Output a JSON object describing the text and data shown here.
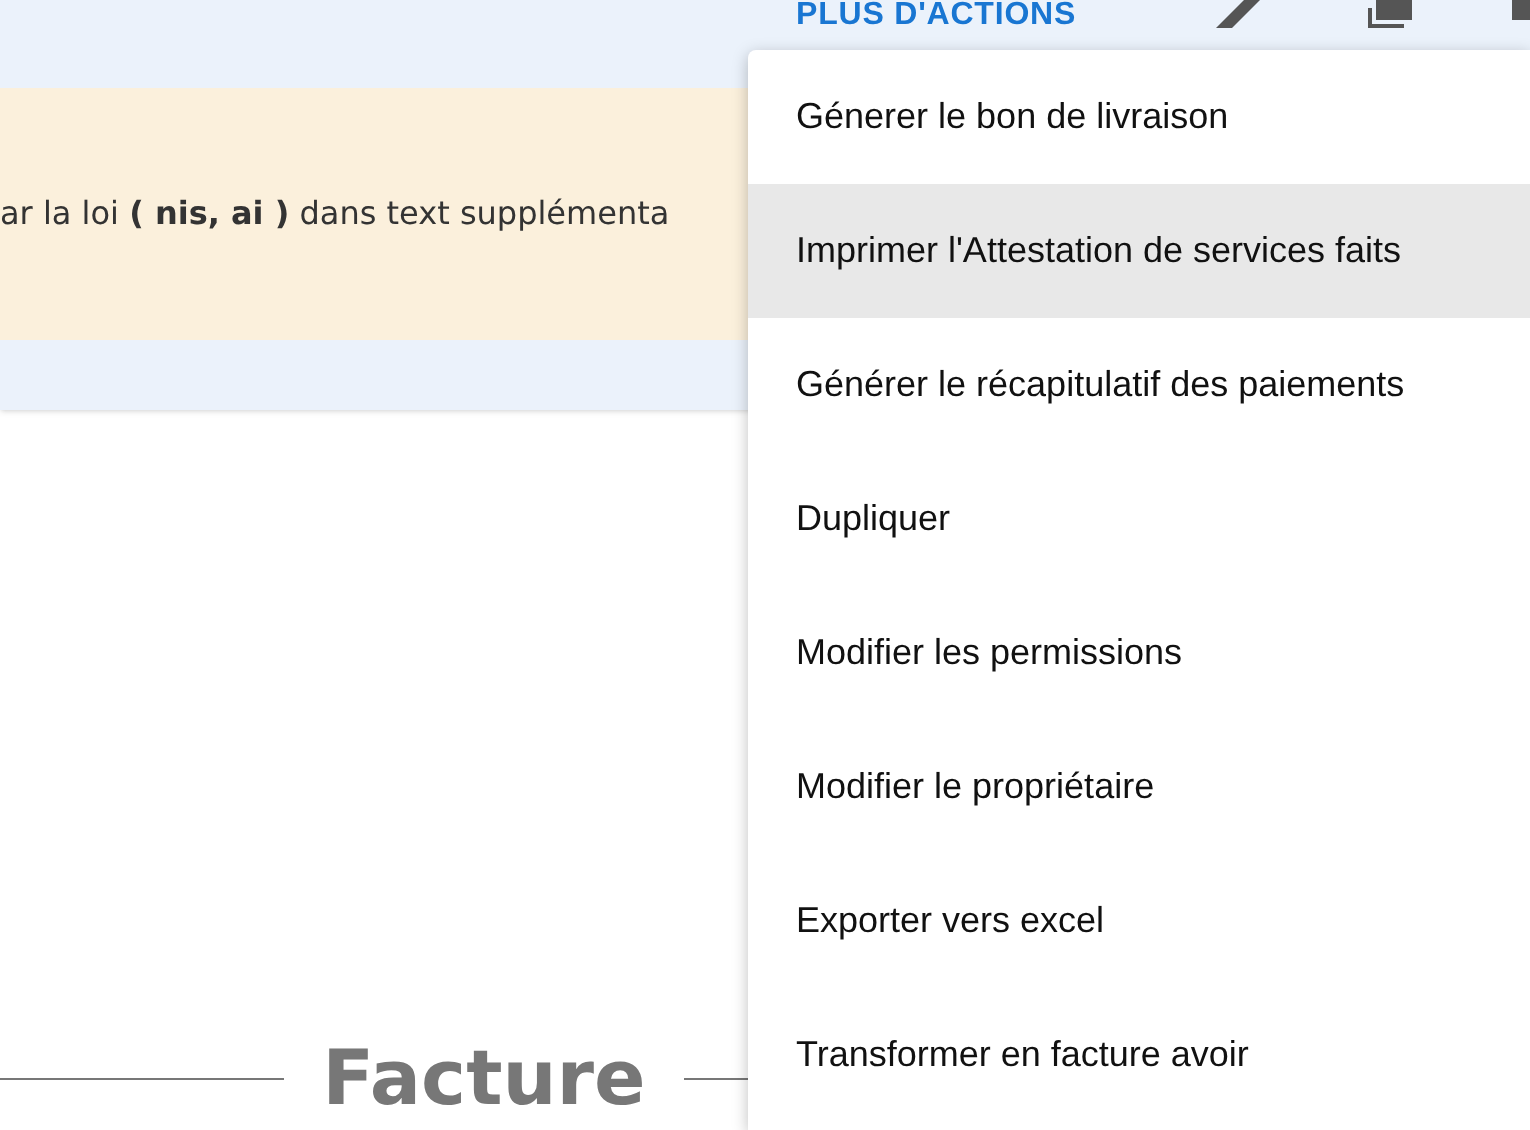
{
  "toolbar": {
    "more_actions": "PLUS D'ACTIONS"
  },
  "banner": {
    "text": "ar la loi **( nis, ai )** dans text supplémenta"
  },
  "document": {
    "title": "Facture"
  },
  "menu": {
    "items": [
      {
        "label": "Génerer le bon de livraison",
        "selected": false
      },
      {
        "label": "Imprimer l'Attestation de services faits",
        "selected": true
      },
      {
        "label": "Générer le récapitulatif des paiements",
        "selected": false
      },
      {
        "label": "Dupliquer",
        "selected": false
      },
      {
        "label": "Modifier les permissions",
        "selected": false
      },
      {
        "label": "Modifier le propriétaire",
        "selected": false
      },
      {
        "label": "Exporter vers excel",
        "selected": false
      },
      {
        "label": "Transformer en facture avoir",
        "selected": false
      }
    ]
  }
}
